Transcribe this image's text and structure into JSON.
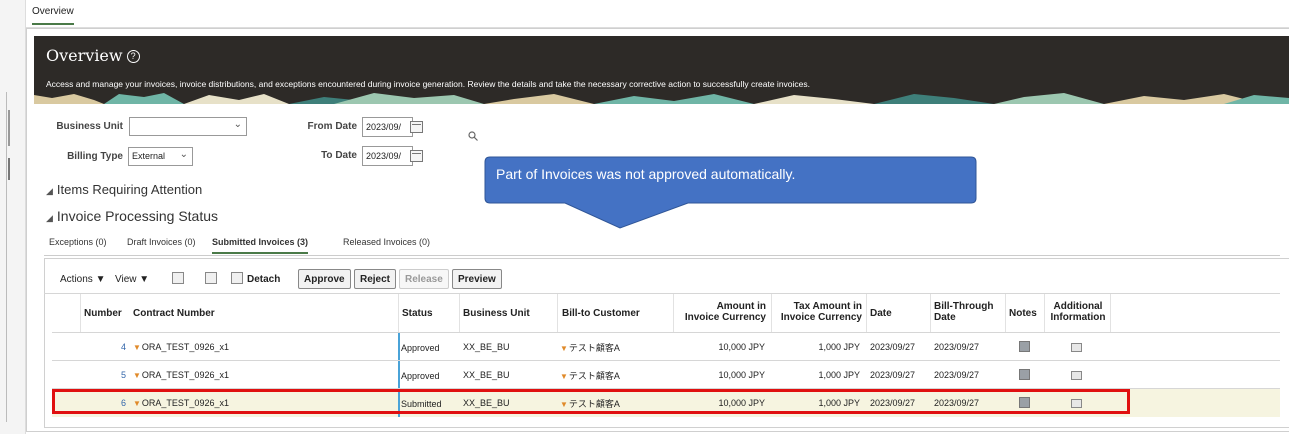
{
  "top_tab": "Overview",
  "banner": {
    "title": "Overview",
    "help_glyph": "?",
    "description": "Access and manage your invoices, invoice distributions, and exceptions encountered during invoice generation. Review the details and take the necessary corrective action to successfully create invoices."
  },
  "filters": {
    "business_unit_label": "Business Unit",
    "business_unit_value": "",
    "billing_type_label": "Billing Type",
    "billing_type_value": "External",
    "from_date_label": "From Date",
    "from_date_value": "2023/09/",
    "to_date_label": "To Date",
    "to_date_value": "2023/09/"
  },
  "callout": {
    "text": "Part of Invoices was not approved automatically.",
    "fill": "#4472c4"
  },
  "sections": {
    "items_requiring_attention": "Items Requiring Attention",
    "invoice_processing_status": "Invoice Processing Status"
  },
  "subtabs": [
    {
      "label": "Exceptions (0)"
    },
    {
      "label": "Draft Invoices (0)"
    },
    {
      "label": "Submitted Invoices (3)"
    },
    {
      "label": "Released Invoices (0)"
    }
  ],
  "toolbar": {
    "actions": "Actions ▼",
    "view": "View ▼",
    "detach": "Detach",
    "approve": "Approve",
    "reject": "Reject",
    "release": "Release",
    "preview": "Preview"
  },
  "table": {
    "headers": {
      "number": "Number",
      "contract_number": "Contract Number",
      "status": "Status",
      "business_unit": "Business Unit",
      "bill_to_customer": "Bill-to Customer",
      "amount_1": "Amount in",
      "amount_2": "Invoice Currency",
      "tax_1": "Tax Amount in",
      "tax_2": "Invoice Currency",
      "date": "Date",
      "bill_through_1": "Bill-Through",
      "bill_through_2": "Date",
      "notes": "Notes",
      "additional_1": "Additional",
      "additional_2": "Information"
    },
    "rows": [
      {
        "number": "4",
        "contract": "ORA_TEST_0926_x1",
        "status": "Approved",
        "business_unit": "XX_BE_BU",
        "customer": "テスト顧客A",
        "amount": "10,000 JPY",
        "tax": "1,000 JPY",
        "date": "2023/09/27",
        "bill_through": "2023/09/27"
      },
      {
        "number": "5",
        "contract": "ORA_TEST_0926_x1",
        "status": "Approved",
        "business_unit": "XX_BE_BU",
        "customer": "テスト顧客A",
        "amount": "10,000 JPY",
        "tax": "1,000 JPY",
        "date": "2023/09/27",
        "bill_through": "2023/09/27"
      },
      {
        "number": "6",
        "contract": "ORA_TEST_0926_x1",
        "status": "Submitted",
        "business_unit": "XX_BE_BU",
        "customer": "テスト顧客A",
        "amount": "10,000 JPY",
        "tax": "1,000 JPY",
        "date": "2023/09/27",
        "bill_through": "2023/09/27"
      }
    ]
  },
  "highlight_color": "#e01010"
}
